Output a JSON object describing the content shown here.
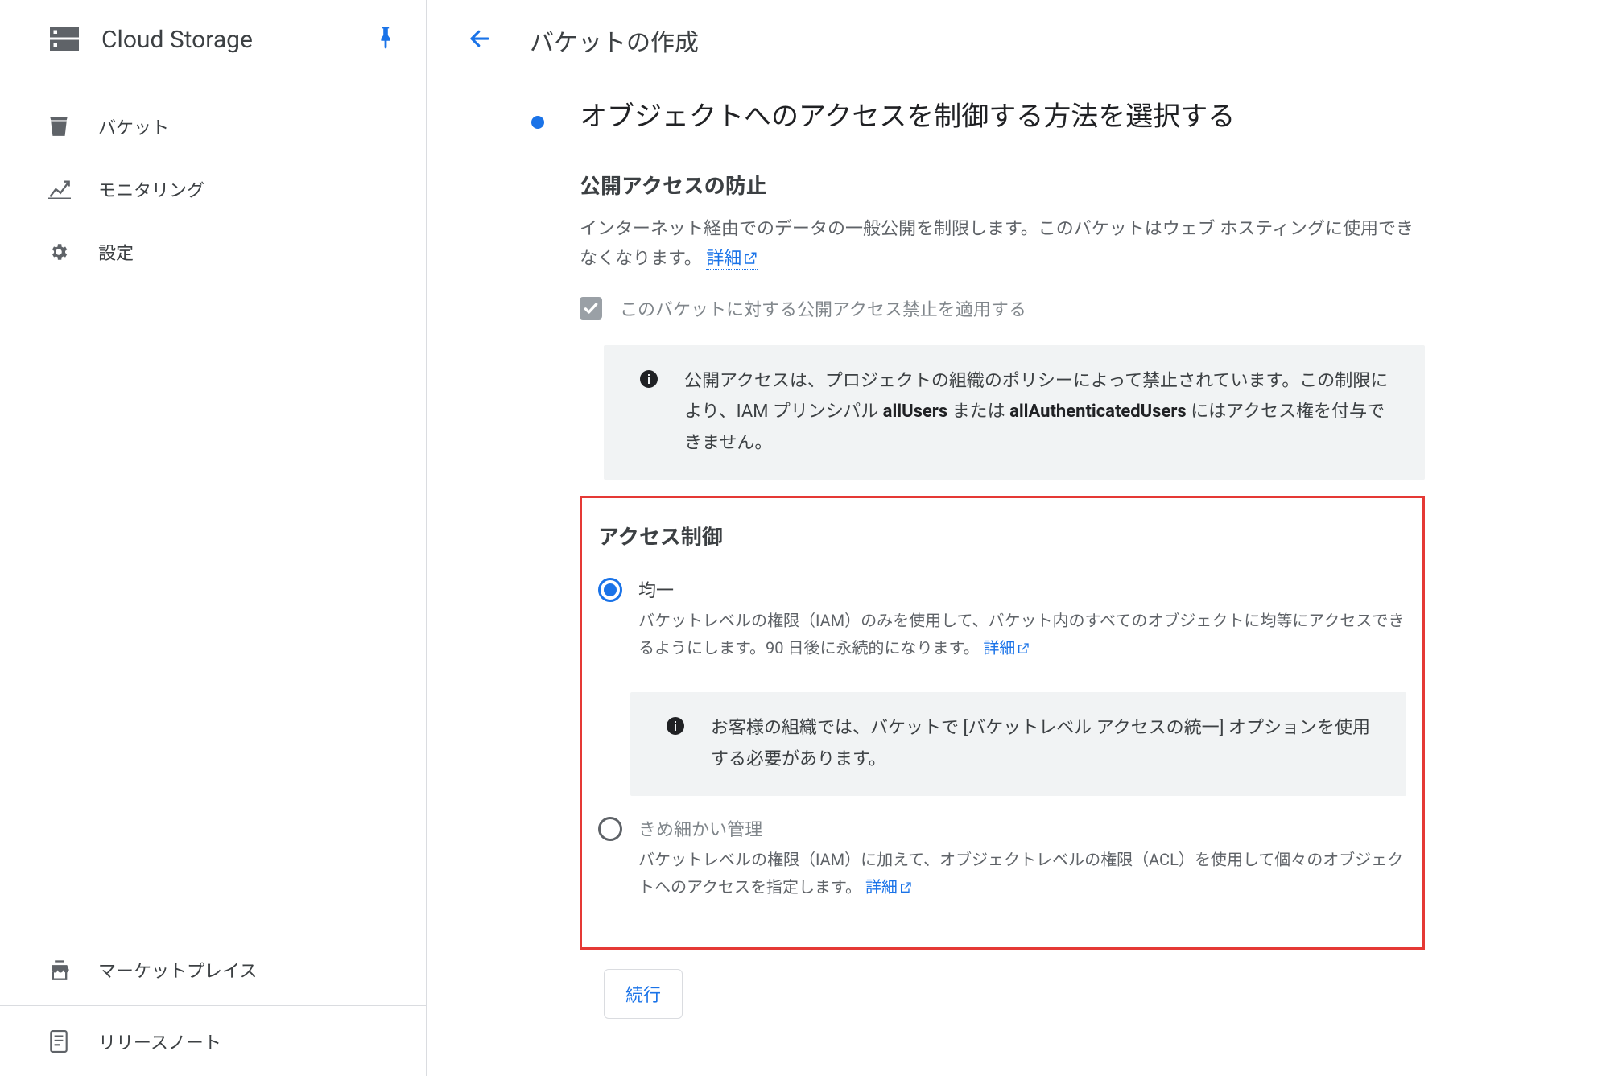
{
  "product": {
    "name": "Cloud Storage"
  },
  "sidebar": {
    "items": [
      {
        "label": "バケット"
      },
      {
        "label": "モニタリング"
      },
      {
        "label": "設定"
      }
    ],
    "footer": [
      {
        "label": "マーケットプレイス"
      },
      {
        "label": "リリースノート"
      }
    ]
  },
  "header": {
    "title": "バケットの作成"
  },
  "step": {
    "title": "オブジェクトへのアクセスを制御する方法を選択する",
    "public_access": {
      "heading": "公開アクセスの防止",
      "description_pre": "インターネット経由でのデータの一般公開を制限します。このバケットはウェブ ホスティングに使用できなくなります。",
      "learn_more": "詳細",
      "checkbox_label": "このバケットに対する公開アクセス禁止を適用する",
      "info_pre": "公開アクセスは、プロジェクトの組織のポリシーによって禁止されています。この制限により、IAM プリンシパル ",
      "info_b1": "allUsers",
      "info_mid": " または ",
      "info_b2": "allAuthenticatedUsers",
      "info_post": " にはアクセス権を付与できません。"
    },
    "access_control": {
      "heading": "アクセス制御",
      "uniform": {
        "label": "均一",
        "desc_pre": "バケットレベルの権限（IAM）のみを使用して、バケット内のすべてのオブジェクトに均等にアクセスできるようにします。90 日後に永続的になります。",
        "learn_more": "詳細",
        "info": "お客様の組織では、バケットで [バケットレベル アクセスの統一] オプションを使用する必要があります。"
      },
      "fine": {
        "label": "きめ細かい管理",
        "desc_pre": "バケットレベルの権限（IAM）に加えて、オブジェクトレベルの権限（ACL）を使用して個々のオブジェクトへのアクセスを指定します。",
        "learn_more": "詳細"
      }
    },
    "continue_label": "続行"
  }
}
